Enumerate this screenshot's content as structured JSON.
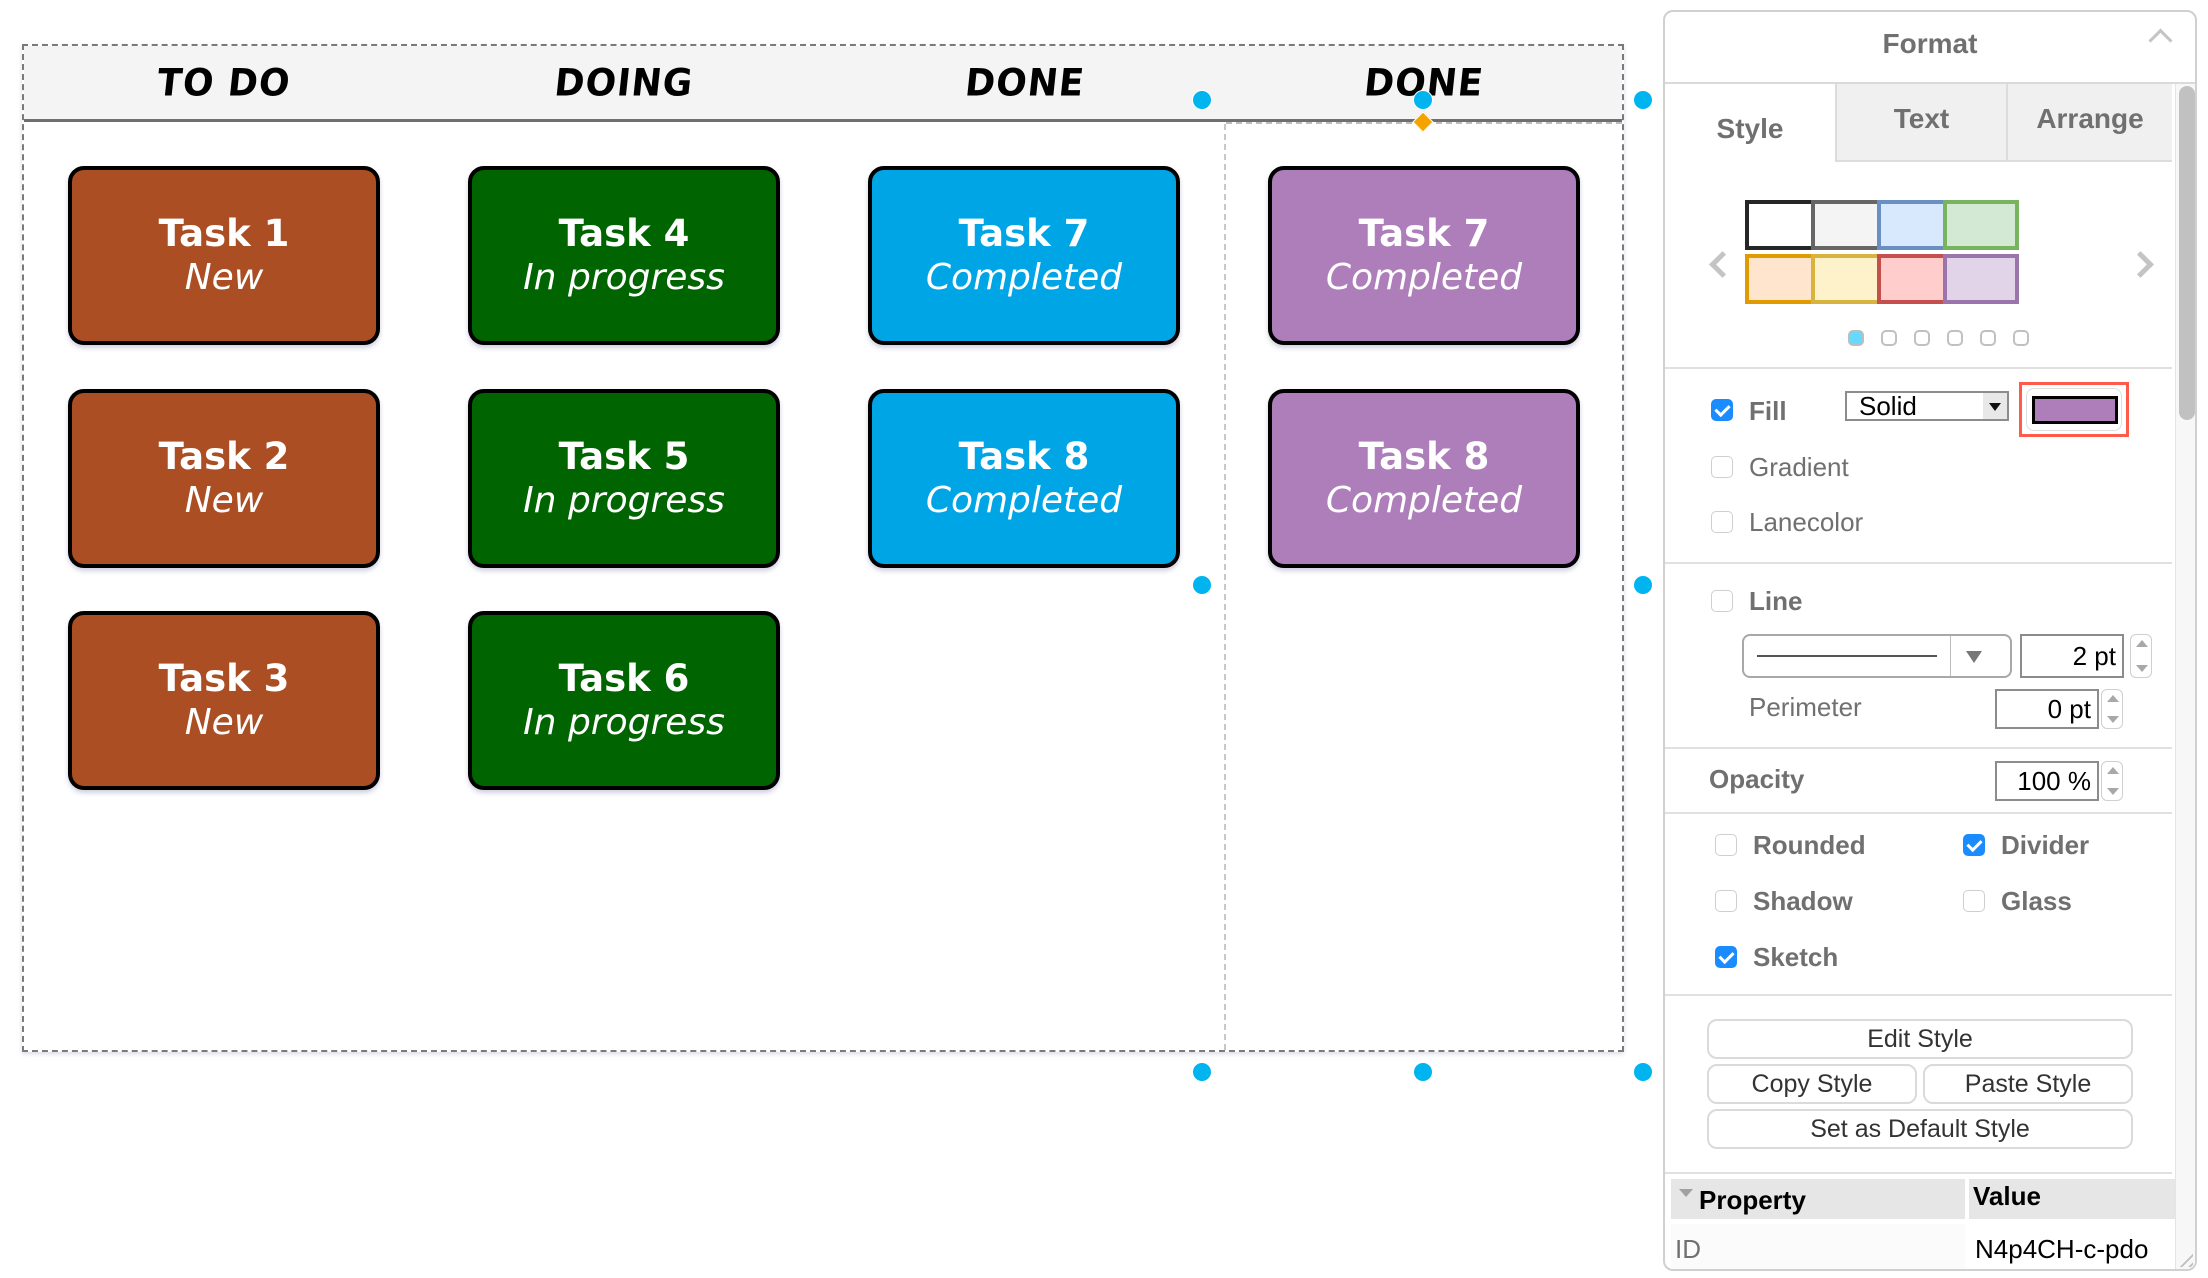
{
  "board": {
    "columns": [
      {
        "label": "TO DO"
      },
      {
        "label": "DOING"
      },
      {
        "label": "DONE"
      },
      {
        "label": "DONE"
      }
    ],
    "cards": [
      {
        "title": "Task 1",
        "status": "New",
        "fill": "#ab4e23"
      },
      {
        "title": "Task 2",
        "status": "New",
        "fill": "#ab4e23"
      },
      {
        "title": "Task 3",
        "status": "New",
        "fill": "#ab4e23"
      },
      {
        "title": "Task 4",
        "status": "In progress",
        "fill": "#006400"
      },
      {
        "title": "Task 5",
        "status": "In progress",
        "fill": "#006400"
      },
      {
        "title": "Task 6",
        "status": "In progress",
        "fill": "#006400"
      },
      {
        "title": "Task 7",
        "status": "Completed",
        "fill": "#00a5e6"
      },
      {
        "title": "Task 8",
        "status": "Completed",
        "fill": "#00a5e6"
      },
      {
        "title": "Task 7",
        "status": "Completed",
        "fill": "#ad7eba"
      },
      {
        "title": "Task 8",
        "status": "Completed",
        "fill": "#ad7eba"
      }
    ],
    "selection_color": "#00b4f0",
    "anchor_color": "#f4a300"
  },
  "panel": {
    "title": "Format",
    "tabs": [
      {
        "label": "Style",
        "active": true
      },
      {
        "label": "Text",
        "active": false
      },
      {
        "label": "Arrange",
        "active": false
      }
    ],
    "swatches": [
      {
        "fill": "#ffffff",
        "stroke": "#262626"
      },
      {
        "fill": "#f4f4f4",
        "stroke": "#666666"
      },
      {
        "fill": "#d8e8fd",
        "stroke": "#6a8fc3"
      },
      {
        "fill": "#d3e9d4",
        "stroke": "#78b45f"
      },
      {
        "fill": "#ffe5cd",
        "stroke": "#e09b00"
      },
      {
        "fill": "#fef2ca",
        "stroke": "#d8b340"
      },
      {
        "fill": "#ffcdcc",
        "stroke": "#c44f4d"
      },
      {
        "fill": "#e2d4e8",
        "stroke": "#9a74aa"
      }
    ],
    "swatch_pages": 6,
    "swatch_page_active": 1,
    "fill": {
      "label": "Fill",
      "checked": true,
      "type_value": "Solid",
      "color": "#ad7eba"
    },
    "gradient": {
      "label": "Gradient",
      "checked": false
    },
    "lanecolor": {
      "label": "Lanecolor",
      "checked": false
    },
    "line": {
      "label": "Line",
      "checked": false,
      "width_value": "2 pt"
    },
    "perimeter": {
      "label": "Perimeter",
      "value": "0 pt"
    },
    "opacity": {
      "label": "Opacity",
      "value": "100 %"
    },
    "options": [
      {
        "label": "Rounded",
        "checked": false
      },
      {
        "label": "Divider",
        "checked": true
      },
      {
        "label": "Shadow",
        "checked": false
      },
      {
        "label": "Glass",
        "checked": false
      },
      {
        "label": "Sketch",
        "checked": true
      }
    ],
    "buttons": {
      "edit_style": "Edit Style",
      "copy_style": "Copy Style",
      "paste_style": "Paste Style",
      "set_default": "Set as Default Style"
    },
    "properties": {
      "header_property": "Property",
      "header_value": "Value",
      "rows": [
        {
          "property": "ID",
          "value": "N4p4CH-c-pdo"
        }
      ]
    }
  }
}
